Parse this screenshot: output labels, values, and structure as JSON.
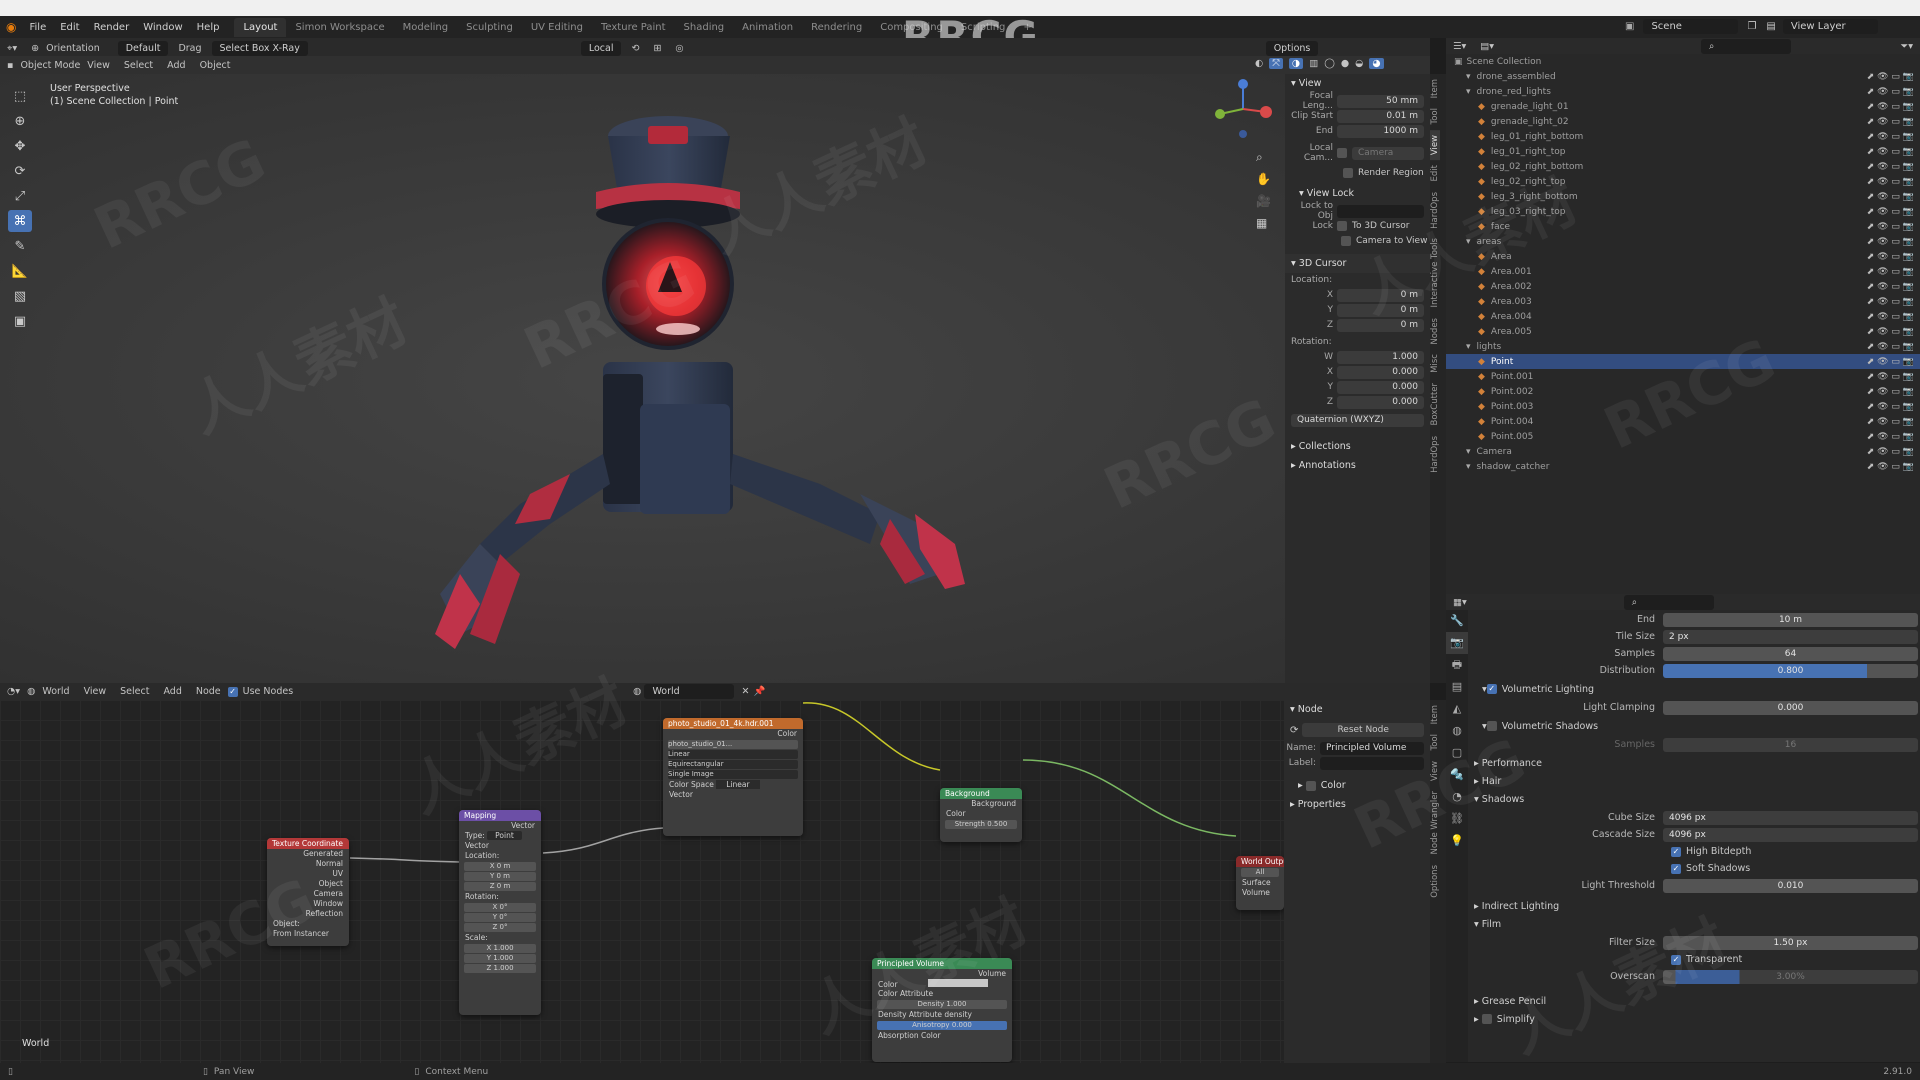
{
  "app": {
    "watermark_title": "RRCG",
    "watermark_cn": "人人素材",
    "version": "2.91.0"
  },
  "menu": [
    "File",
    "Edit",
    "Render",
    "Window",
    "Help"
  ],
  "workspaces": [
    "Layout",
    "Simon Workspace",
    "Modeling",
    "Sculpting",
    "UV Editing",
    "Texture Paint",
    "Shading",
    "Animation",
    "Rendering",
    "Compositing",
    "Scripting"
  ],
  "scene": {
    "name": "Scene",
    "view_layer": "View Layer"
  },
  "viewport": {
    "header": {
      "orientation_label": "Orientation",
      "orientation": "Default",
      "drag_label": "Drag",
      "drag": "Select Box X-Ray",
      "transform": "Local",
      "options": "Options",
      "mode": "Object Mode",
      "menus": [
        "View",
        "Select",
        "Add",
        "Object"
      ]
    },
    "overlay_title": "User Perspective",
    "overlay_sub": "(1) Scene Collection | Point"
  },
  "npanel": {
    "view": "View",
    "focal_label": "Focal Leng...",
    "focal": "50 mm",
    "clip_start_label": "Clip Start",
    "clip_start": "0.01 m",
    "end_label": "End",
    "end": "1000 m",
    "local_cam_label": "Local Cam...",
    "camera": "Camera",
    "render_region": "Render Region",
    "view_lock": "View Lock",
    "lock_obj": "Lock to Obj",
    "lock": "Lock",
    "to_cursor": "To 3D Cursor",
    "cam_to_view": "Camera to View",
    "cursor": "3D Cursor",
    "location": "Location:",
    "loc": [
      {
        "k": "X",
        "v": "0 m"
      },
      {
        "k": "Y",
        "v": "0 m"
      },
      {
        "k": "Z",
        "v": "0 m"
      }
    ],
    "rotation": "Rotation:",
    "rot": [
      {
        "k": "W",
        "v": "1.000"
      },
      {
        "k": "X",
        "v": "0.000"
      },
      {
        "k": "Y",
        "v": "0.000"
      },
      {
        "k": "Z",
        "v": "0.000"
      }
    ],
    "mode": "Quaternion (WXYZ)",
    "collections": "Collections",
    "annotations": "Annotations"
  },
  "vtabs_top": [
    "Item",
    "Tool",
    "View",
    "Edit",
    "HardOps",
    "Interactive Tools",
    "Nodes",
    "Misc",
    "BoxCutter",
    "HardOps"
  ],
  "vtabs_bottom": [
    "Item",
    "Tool",
    "View",
    "Node Wrangler",
    "Options"
  ],
  "outliner": {
    "title": "Scene Collection",
    "rows": [
      {
        "name": "drone_assembled",
        "depth": 1,
        "sel": false
      },
      {
        "name": "drone_red_lights",
        "depth": 1,
        "sel": false
      },
      {
        "name": "grenade_light_01",
        "depth": 2,
        "sel": false
      },
      {
        "name": "grenade_light_02",
        "depth": 2,
        "sel": false
      },
      {
        "name": "leg_01_right_bottom",
        "depth": 2,
        "sel": false
      },
      {
        "name": "leg_01_right_top",
        "depth": 2,
        "sel": false
      },
      {
        "name": "leg_02_right_bottom",
        "depth": 2,
        "sel": false
      },
      {
        "name": "leg_02_right_top",
        "depth": 2,
        "sel": false
      },
      {
        "name": "leg_3_right_bottom",
        "depth": 2,
        "sel": false
      },
      {
        "name": "leg_03_right_top",
        "depth": 2,
        "sel": false
      },
      {
        "name": "face",
        "depth": 2,
        "sel": false
      },
      {
        "name": "areas",
        "depth": 1,
        "sel": false
      },
      {
        "name": "Area",
        "depth": 2,
        "sel": false
      },
      {
        "name": "Area.001",
        "depth": 2,
        "sel": false
      },
      {
        "name": "Area.002",
        "depth": 2,
        "sel": false
      },
      {
        "name": "Area.003",
        "depth": 2,
        "sel": false
      },
      {
        "name": "Area.004",
        "depth": 2,
        "sel": false
      },
      {
        "name": "Area.005",
        "depth": 2,
        "sel": false
      },
      {
        "name": "lights",
        "depth": 1,
        "sel": false
      },
      {
        "name": "Point",
        "depth": 2,
        "sel": true
      },
      {
        "name": "Point.001",
        "depth": 2,
        "sel": false
      },
      {
        "name": "Point.002",
        "depth": 2,
        "sel": false
      },
      {
        "name": "Point.003",
        "depth": 2,
        "sel": false
      },
      {
        "name": "Point.004",
        "depth": 2,
        "sel": false
      },
      {
        "name": "Point.005",
        "depth": 2,
        "sel": false
      },
      {
        "name": "Camera",
        "depth": 1,
        "sel": false
      },
      {
        "name": "shadow_catcher",
        "depth": 1,
        "sel": false
      }
    ]
  },
  "props": {
    "end_label": "End",
    "end": "10 m",
    "tile_label": "Tile Size",
    "tile": "2 px",
    "samples_label": "Samples",
    "samples": "64",
    "dist_label": "Distribution",
    "dist": "0.800",
    "vol_light": "Volumetric Lighting",
    "clamp_label": "Light Clamping",
    "clamp": "0.000",
    "vol_shadows": "Volumetric Shadows",
    "vs_samples_label": "Samples",
    "vs_samples": "16",
    "performance": "Performance",
    "hair": "Hair",
    "shadows": "Shadows",
    "cube_label": "Cube Size",
    "cube": "4096 px",
    "cascade_label": "Cascade Size",
    "cascade": "4096 px",
    "high_bit": "High Bitdepth",
    "soft": "Soft Shadows",
    "thresh_label": "Light Threshold",
    "thresh": "0.010",
    "indirect": "Indirect Lighting",
    "film": "Film",
    "filter_label": "Filter Size",
    "filter": "1.50 px",
    "transparent": "Transparent",
    "overscan_label": "Overscan",
    "overscan": "3.00%",
    "grease": "Grease Pencil",
    "simplify": "Simplify"
  },
  "node_editor": {
    "header": {
      "type": "World",
      "menus": [
        "View",
        "Select",
        "Add",
        "Node"
      ],
      "use_nodes": "Use Nodes",
      "world": "World"
    },
    "footer_label": "World",
    "panel": {
      "title": "Node",
      "reset": "Reset Node",
      "name_label": "Name:",
      "name": "Principled Volume",
      "label_label": "Label:",
      "color": "Color",
      "properties": "Properties"
    },
    "nodes": {
      "texcoord": {
        "title": "Texture Coordinate",
        "outs": [
          "Generated",
          "Normal",
          "UV",
          "Object",
          "Camera",
          "Window",
          "Reflection"
        ],
        "object": "Object:",
        "from_instancer": "From Instancer"
      },
      "mapping": {
        "title": "Mapping",
        "vector": "Vector",
        "type_label": "Type:",
        "type": "Point",
        "vector_in": "Vector",
        "location": "Location:",
        "loc": [
          {
            "k": "X",
            "v": "0 m"
          },
          {
            "k": "Y",
            "v": "0 m"
          },
          {
            "k": "Z",
            "v": "0 m"
          }
        ],
        "rotation": "Rotation:",
        "rot": [
          {
            "k": "X",
            "v": "0°"
          },
          {
            "k": "Y",
            "v": "0°"
          },
          {
            "k": "Z",
            "v": "0°"
          }
        ],
        "scale": "Scale:",
        "scl": [
          {
            "k": "X",
            "v": "1.000"
          },
          {
            "k": "Y",
            "v": "1.000"
          },
          {
            "k": "Z",
            "v": "1.000"
          }
        ]
      },
      "env": {
        "title": "photo_studio_01_4k.hdr.001",
        "color": "Color",
        "image": "photo_studio_01...",
        "interp": "Linear",
        "proj": "Equirectangular",
        "ext": "Single Image",
        "cs_label": "Color Space",
        "cs": "Linear",
        "vector": "Vector"
      },
      "bg": {
        "title": "Background",
        "out": "Background",
        "color": "Color",
        "strength_label": "Strength",
        "strength": "0.500"
      },
      "volume": {
        "title": "Principled Volume",
        "out": "Volume",
        "color": "Color",
        "color_attr": "Color Attribute",
        "density_label": "Density",
        "density": "1.000",
        "density_attr_label": "Density Attribute",
        "density_attr": "density",
        "anis_label": "Anisotropy",
        "anis": "0.000",
        "absorb": "Absorption Color"
      },
      "out": {
        "title": "World Output",
        "target": "All",
        "surface": "Surface",
        "volume": "Volume"
      }
    }
  },
  "status": {
    "pan": "Pan View",
    "ctx": "Context Menu",
    "version": "2.91.0"
  }
}
